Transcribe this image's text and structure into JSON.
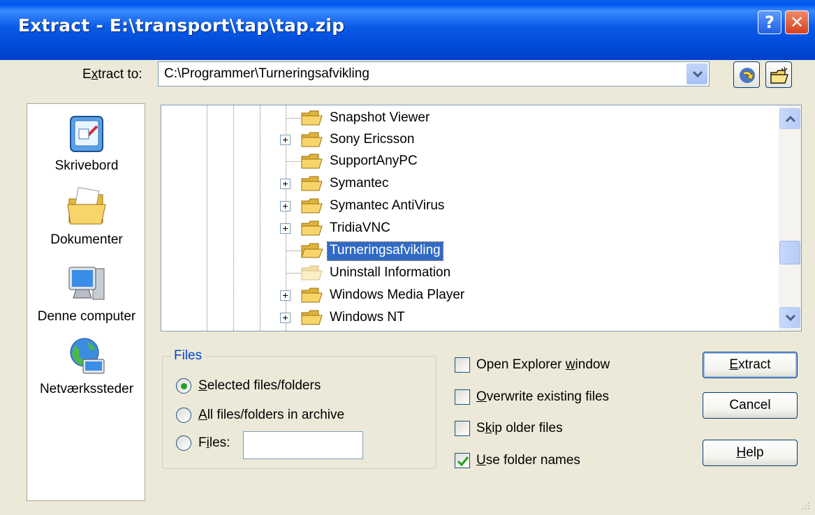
{
  "window": {
    "title": "Extract - E:\\transport\\tap\\tap.zip",
    "help_glyph": "?",
    "close_glyph": "✕"
  },
  "extract_to": {
    "label_pre": "E",
    "label_underlined": "x",
    "label_post": "tract to:",
    "value": "C:\\Programmer\\Turneringsafvikling"
  },
  "places": [
    {
      "label": "Skrivebord",
      "icon": "desktop-icon"
    },
    {
      "label": "Dokumenter",
      "icon": "documents-folder-icon"
    },
    {
      "label": "Denne computer",
      "icon": "my-computer-icon"
    },
    {
      "label": "Netværkssteder",
      "icon": "network-places-icon"
    }
  ],
  "tree": {
    "items": [
      {
        "label": "Snapshot Viewer",
        "expandable": false
      },
      {
        "label": "Sony Ericsson",
        "expandable": true
      },
      {
        "label": "SupportAnyPC",
        "expandable": false
      },
      {
        "label": "Symantec",
        "expandable": true
      },
      {
        "label": "Symantec AntiVirus",
        "expandable": true
      },
      {
        "label": "TridiaVNC",
        "expandable": true
      },
      {
        "label": "Turneringsafvikling",
        "expandable": false,
        "selected": true
      },
      {
        "label": "Uninstall Information",
        "expandable": false,
        "faded": true
      },
      {
        "label": "Windows Media Player",
        "expandable": true
      },
      {
        "label": "Windows NT",
        "expandable": true
      }
    ]
  },
  "files_group": {
    "title": "Files",
    "options": [
      {
        "u": "S",
        "rest": "elected files/folders",
        "checked": true
      },
      {
        "u": "A",
        "rest": "ll files/folders in archive",
        "checked": false
      },
      {
        "pre": "F",
        "u": "i",
        "rest": "les:",
        "checked": false
      }
    ],
    "files_value": ""
  },
  "options": [
    {
      "pre": "Open Explorer ",
      "u": "w",
      "rest": "indow",
      "checked": false
    },
    {
      "pre": "",
      "u": "O",
      "rest": "verwrite existing files",
      "checked": false
    },
    {
      "pre": "S",
      "u": "k",
      "rest": "ip older files",
      "checked": false
    },
    {
      "pre": "",
      "u": "U",
      "rest": "se folder names",
      "checked": true
    }
  ],
  "buttons": {
    "extract": {
      "u": "E",
      "rest": "xtract"
    },
    "cancel": "Cancel",
    "help": {
      "u": "H",
      "rest": "elp"
    }
  },
  "colors": {
    "title_bar": "#0a5ae6",
    "selection": "#316ac5",
    "face": "#ece9d8",
    "group_title": "#0046d5"
  }
}
